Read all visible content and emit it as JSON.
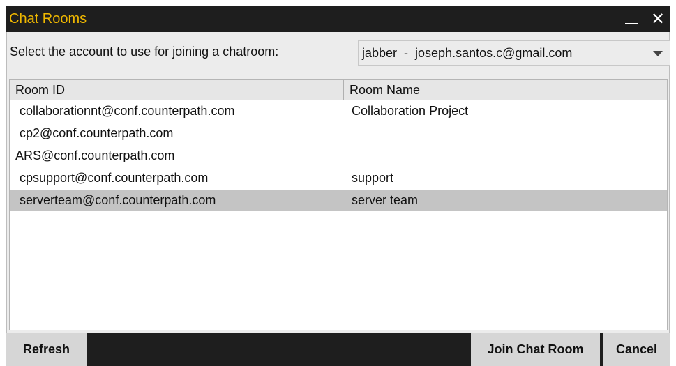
{
  "window": {
    "title": "Chat Rooms",
    "minimize_glyph": "_",
    "close_glyph": "✕"
  },
  "account": {
    "label": "Select the account to use for joining a chatroom:",
    "selected": "jabber  -  joseph.santos.c@gmail.com"
  },
  "table": {
    "headers": [
      "Room ID",
      "Room Name"
    ],
    "rows": [
      {
        "room_id": "collaborationnt@conf.counterpath.com",
        "room_name": "Collaboration Project"
      },
      {
        "room_id": "cp2@conf.counterpath.com",
        "room_name": ""
      },
      {
        "room_id": "ARS@conf.counterpath.com",
        "room_name": ""
      },
      {
        "room_id": "cpsupport@conf.counterpath.com",
        "room_name": "support"
      },
      {
        "room_id": "serverteam@conf.counterpath.com",
        "room_name": "server team"
      }
    ],
    "selected_row": 4
  },
  "buttons": {
    "refresh": "Refresh",
    "join": "Join Chat Room",
    "cancel": "Cancel"
  },
  "colors": {
    "title_text": "#f0b800",
    "titlebar_bg": "#1e1e1e",
    "selected_row_bg": "#c4c4c4"
  }
}
